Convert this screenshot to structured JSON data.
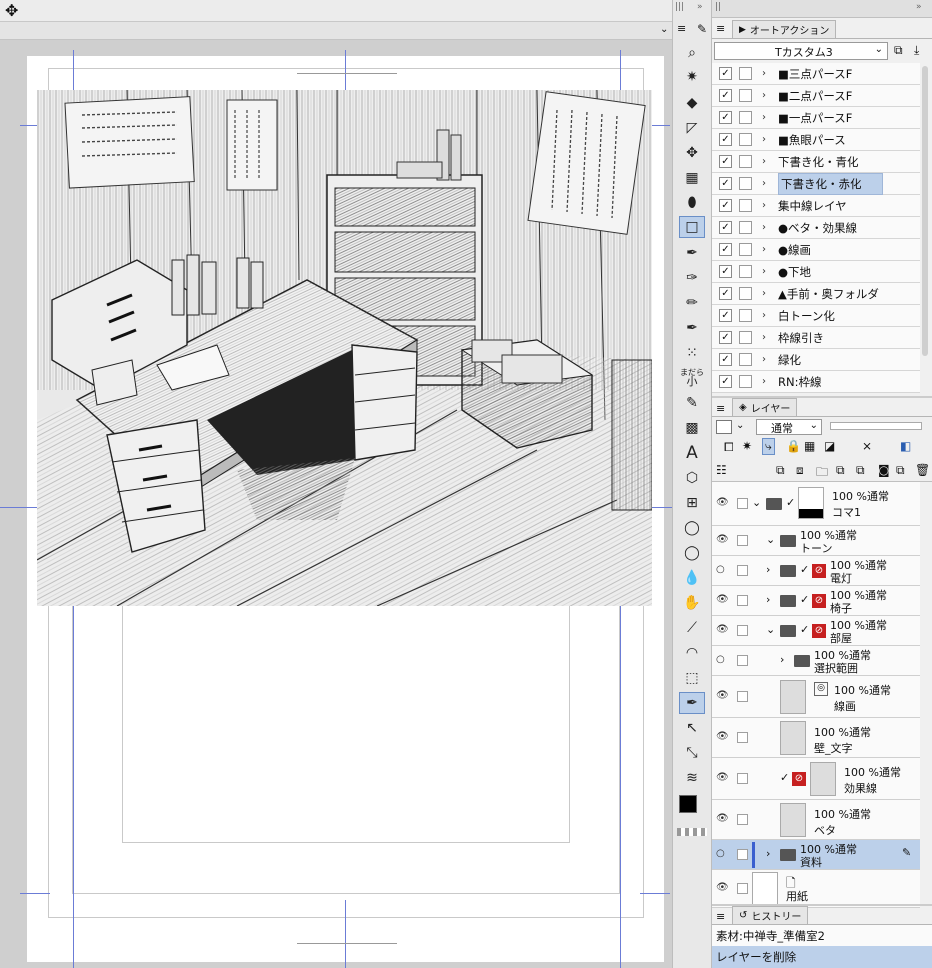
{
  "canvas": {
    "move_icon": "move-icon",
    "menu_arrow": "⌄"
  },
  "toolbar": {
    "tools": [
      "magnifier-icon",
      "sparkle-icon",
      "fill-icon",
      "vector-icon",
      "move-layer-icon",
      "gradient-icon",
      "eraser-icon",
      "rectangle-select-icon",
      "pen-icon",
      "brush-icon",
      "pencil-icon",
      "ink-pen-icon",
      "airbrush-icon",
      "madara-icon",
      "marker-icon",
      "pattern-icon",
      "text-icon",
      "3d-object-icon",
      "frame-icon",
      "balloon-icon",
      "balloon2-icon",
      "blend-icon",
      "hand-icon",
      "ruler-icon",
      "curve-icon",
      "select-icon",
      "lasso-pen-icon",
      "object-select-icon",
      "eyedropper-icon",
      "correct-line-icon"
    ],
    "madara_label": "まだら",
    "madara_sub": "小"
  },
  "autoaction": {
    "tab": "オートアクション",
    "set_name": "Tカスタム3",
    "items": [
      {
        "label": "■三点パースF",
        "checked": true
      },
      {
        "label": "■二点パースF",
        "checked": true
      },
      {
        "label": "■一点パースF",
        "checked": true
      },
      {
        "label": "■魚眼パース",
        "checked": true
      },
      {
        "label": "下書き化・青化",
        "checked": true
      },
      {
        "label": "下書き化・赤化",
        "checked": true,
        "selected": true
      },
      {
        "label": "集中線レイヤ",
        "checked": true
      },
      {
        "label": "●ベタ・効果線",
        "checked": true
      },
      {
        "label": "●線画",
        "checked": true
      },
      {
        "label": "●下地",
        "checked": true
      },
      {
        "label": "▲手前・奥フォルダ",
        "checked": true
      },
      {
        "label": "白トーン化",
        "checked": true
      },
      {
        "label": "枠線引き",
        "checked": true
      },
      {
        "label": "緑化",
        "checked": true
      },
      {
        "label": "RN:枠線",
        "checked": true
      }
    ]
  },
  "layers": {
    "tab": "レイヤー",
    "blend_mode": "通常",
    "items": [
      {
        "mode": "100 %通常",
        "name": "コマ1"
      },
      {
        "mode": "100 %通常",
        "name": "トーン"
      },
      {
        "mode": "100 %通常",
        "name": "電灯"
      },
      {
        "mode": "100 %通常",
        "name": "椅子"
      },
      {
        "mode": "100 %通常",
        "name": "部屋"
      },
      {
        "mode": "100 %通常",
        "name": "選択範囲"
      },
      {
        "mode": "100 %通常",
        "name": "線画"
      },
      {
        "mode": "100 %通常",
        "name": "壁_文字"
      },
      {
        "mode": "100 %通常",
        "name": "効果線"
      },
      {
        "mode": "100 %通常",
        "name": "ベタ"
      },
      {
        "mode": "100 %通常",
        "name": "資料"
      },
      {
        "mode": "",
        "name": "用紙"
      }
    ]
  },
  "history": {
    "tab": "ヒストリー",
    "items": [
      "素材:中禅寺_準備室2",
      "レイヤーを削除"
    ]
  },
  "colors": {
    "main": "#000000",
    "sub": "#ffffff",
    "accent": "#bcd0ea",
    "guide": "#6b7cd6"
  }
}
